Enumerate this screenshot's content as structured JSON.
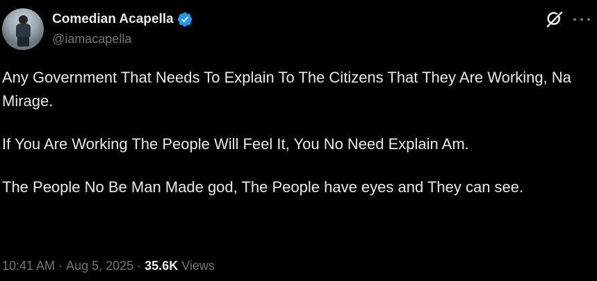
{
  "author": {
    "display_name": "Comedian Acapella",
    "handle": "@iamacapella",
    "verified": true,
    "avatar_icon": "avatar-photo"
  },
  "header_icons": {
    "grok": "grok-icon",
    "more": "more-options-icon"
  },
  "tweet": {
    "paragraphs": [
      "Any Government That Needs To Explain To The Citizens That They Are Working, Na Mirage.",
      "If You Are Working The People Will Feel It, You No Need Explain Am.",
      "The People No Be Man Made god, The People have eyes and They can see."
    ]
  },
  "meta": {
    "time": "10:41 AM",
    "separator": "·",
    "date": "Aug 5, 2025",
    "views_count": "35.6K",
    "views_label": "Views"
  },
  "colors": {
    "background": "#000000",
    "primary_text": "#e7e9ea",
    "secondary_text": "#71767b",
    "verified_badge": "#1d9bf0"
  }
}
